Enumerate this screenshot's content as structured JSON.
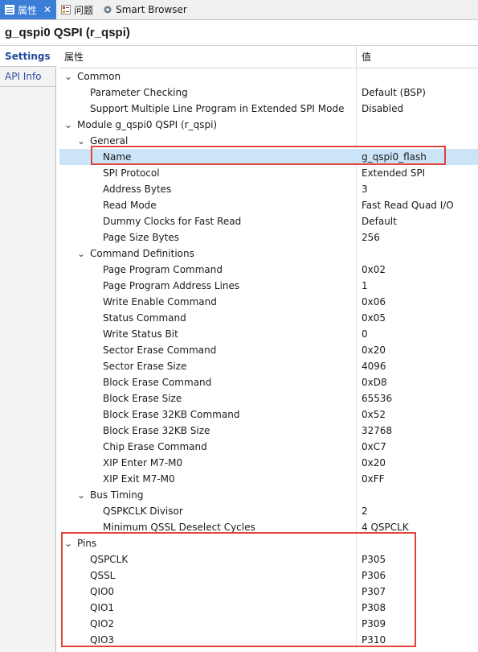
{
  "tabs": [
    {
      "label": "属性",
      "active": true
    },
    {
      "label": "问题",
      "active": false
    },
    {
      "label": "Smart Browser",
      "active": false
    }
  ],
  "page_title": "g_qspi0 QSPI (r_qspi)",
  "side_tabs": [
    {
      "label": "Settings",
      "active": true
    },
    {
      "label": "API Info",
      "active": false
    }
  ],
  "grid_header": {
    "property": "属性",
    "value": "值"
  },
  "rows": [
    {
      "label": "Common",
      "value": "",
      "level": 0,
      "expander": "open"
    },
    {
      "label": "Parameter Checking",
      "value": "Default (BSP)",
      "level": 1,
      "expander": "none"
    },
    {
      "label": "Support Multiple Line Program in Extended SPI Mode",
      "value": "Disabled",
      "level": 1,
      "expander": "none"
    },
    {
      "label": "Module g_qspi0 QSPI (r_qspi)",
      "value": "",
      "level": 0,
      "expander": "open"
    },
    {
      "label": "General",
      "value": "",
      "level": 1,
      "expander": "open"
    },
    {
      "label": "Name",
      "value": "g_qspi0_flash",
      "level": 2,
      "expander": "none",
      "selected": true
    },
    {
      "label": "SPI Protocol",
      "value": "Extended SPI",
      "level": 2,
      "expander": "none"
    },
    {
      "label": "Address Bytes",
      "value": "3",
      "level": 2,
      "expander": "none"
    },
    {
      "label": "Read Mode",
      "value": "Fast Read Quad I/O",
      "level": 2,
      "expander": "none"
    },
    {
      "label": "Dummy Clocks for Fast Read",
      "value": "Default",
      "level": 2,
      "expander": "none"
    },
    {
      "label": "Page Size Bytes",
      "value": "256",
      "level": 2,
      "expander": "none"
    },
    {
      "label": "Command Definitions",
      "value": "",
      "level": 1,
      "expander": "open"
    },
    {
      "label": "Page Program Command",
      "value": "0x02",
      "level": 2,
      "expander": "none"
    },
    {
      "label": "Page Program Address Lines",
      "value": "1",
      "level": 2,
      "expander": "none"
    },
    {
      "label": "Write Enable Command",
      "value": "0x06",
      "level": 2,
      "expander": "none"
    },
    {
      "label": "Status Command",
      "value": "0x05",
      "level": 2,
      "expander": "none"
    },
    {
      "label": "Write Status Bit",
      "value": "0",
      "level": 2,
      "expander": "none"
    },
    {
      "label": "Sector Erase Command",
      "value": "0x20",
      "level": 2,
      "expander": "none"
    },
    {
      "label": "Sector Erase Size",
      "value": "4096",
      "level": 2,
      "expander": "none"
    },
    {
      "label": "Block Erase Command",
      "value": "0xD8",
      "level": 2,
      "expander": "none"
    },
    {
      "label": "Block Erase Size",
      "value": "65536",
      "level": 2,
      "expander": "none"
    },
    {
      "label": "Block Erase 32KB Command",
      "value": "0x52",
      "level": 2,
      "expander": "none"
    },
    {
      "label": "Block Erase 32KB Size",
      "value": "32768",
      "level": 2,
      "expander": "none"
    },
    {
      "label": "Chip Erase Command",
      "value": "0xC7",
      "level": 2,
      "expander": "none"
    },
    {
      "label": "XIP Enter M7-M0",
      "value": "0x20",
      "level": 2,
      "expander": "none"
    },
    {
      "label": "XIP Exit M7-M0",
      "value": "0xFF",
      "level": 2,
      "expander": "none"
    },
    {
      "label": "Bus Timing",
      "value": "",
      "level": 1,
      "expander": "open"
    },
    {
      "label": "QSPKCLK Divisor",
      "value": "2",
      "level": 2,
      "expander": "none"
    },
    {
      "label": "Minimum QSSL Deselect Cycles",
      "value": "4 QSPCLK",
      "level": 2,
      "expander": "none"
    },
    {
      "label": "Pins",
      "value": "",
      "level": 0,
      "expander": "open"
    },
    {
      "label": "QSPCLK",
      "value": "P305",
      "level": 1,
      "expander": "none"
    },
    {
      "label": "QSSL",
      "value": "P306",
      "level": 1,
      "expander": "none"
    },
    {
      "label": "QIO0",
      "value": "P307",
      "level": 1,
      "expander": "none"
    },
    {
      "label": "QIO1",
      "value": "P308",
      "level": 1,
      "expander": "none"
    },
    {
      "label": "QIO2",
      "value": "P309",
      "level": 1,
      "expander": "none"
    },
    {
      "label": "QIO3",
      "value": "P310",
      "level": 1,
      "expander": "none"
    }
  ],
  "colors": {
    "accent": "#3b7ed8",
    "selection": "#cce4f7",
    "annotation": "#e0443a"
  }
}
